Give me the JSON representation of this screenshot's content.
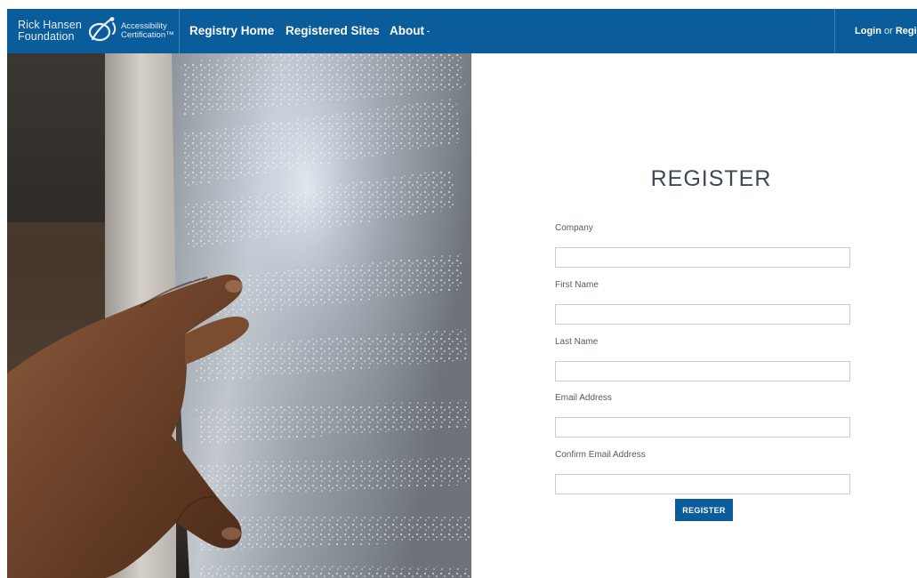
{
  "nav": {
    "brand": {
      "line1": "Rick Hansen",
      "line2": "Foundation",
      "sub1": "Accessibility",
      "sub2": "Certification™"
    },
    "links": [
      "Registry Home",
      "Registered Sites",
      "About"
    ],
    "about_caret": "-",
    "login": "Login",
    "or": " or ",
    "register": "Registe"
  },
  "form": {
    "title": "REGISTER",
    "fields": [
      {
        "label": "Company",
        "value": ""
      },
      {
        "label": "First Name",
        "value": ""
      },
      {
        "label": "Last Name",
        "value": ""
      },
      {
        "label": "Email Address",
        "value": ""
      },
      {
        "label": "Confirm Email Address",
        "value": ""
      }
    ],
    "submit_label": "REGISTER"
  },
  "colors": {
    "nav_bg": "#0b5c9a",
    "button_bg": "#0b5c9a",
    "title_text": "#3f4853"
  },
  "icons": {
    "brand_logo": "wheelchair-figure-logo"
  }
}
